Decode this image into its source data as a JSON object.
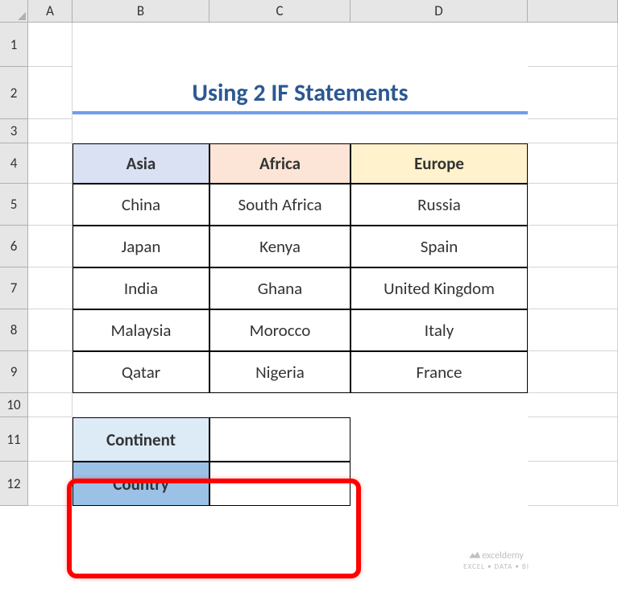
{
  "columns": [
    "A",
    "B",
    "C",
    "D"
  ],
  "rows": [
    "1",
    "2",
    "3",
    "4",
    "5",
    "6",
    "7",
    "8",
    "9",
    "10",
    "11",
    "12"
  ],
  "title": "Using 2 IF Statements",
  "chart_data": {
    "type": "table",
    "title": "Using 2 IF Statements",
    "headers": [
      "Asia",
      "Africa",
      "Europe"
    ],
    "data": [
      [
        "China",
        "South Africa",
        "Russia"
      ],
      [
        "Japan",
        "Kenya",
        "Spain"
      ],
      [
        "India",
        "Ghana",
        "United Kingdom"
      ],
      [
        "Malaysia",
        "Morocco",
        "Italy"
      ],
      [
        "Qatar",
        "Nigeria",
        "France"
      ]
    ]
  },
  "lookup": {
    "continent_label": "Continent",
    "country_label": "Country",
    "continent_value": "",
    "country_value": ""
  },
  "watermark": {
    "brand": "exceldemy",
    "tagline": "EXCEL • DATA • BI"
  }
}
